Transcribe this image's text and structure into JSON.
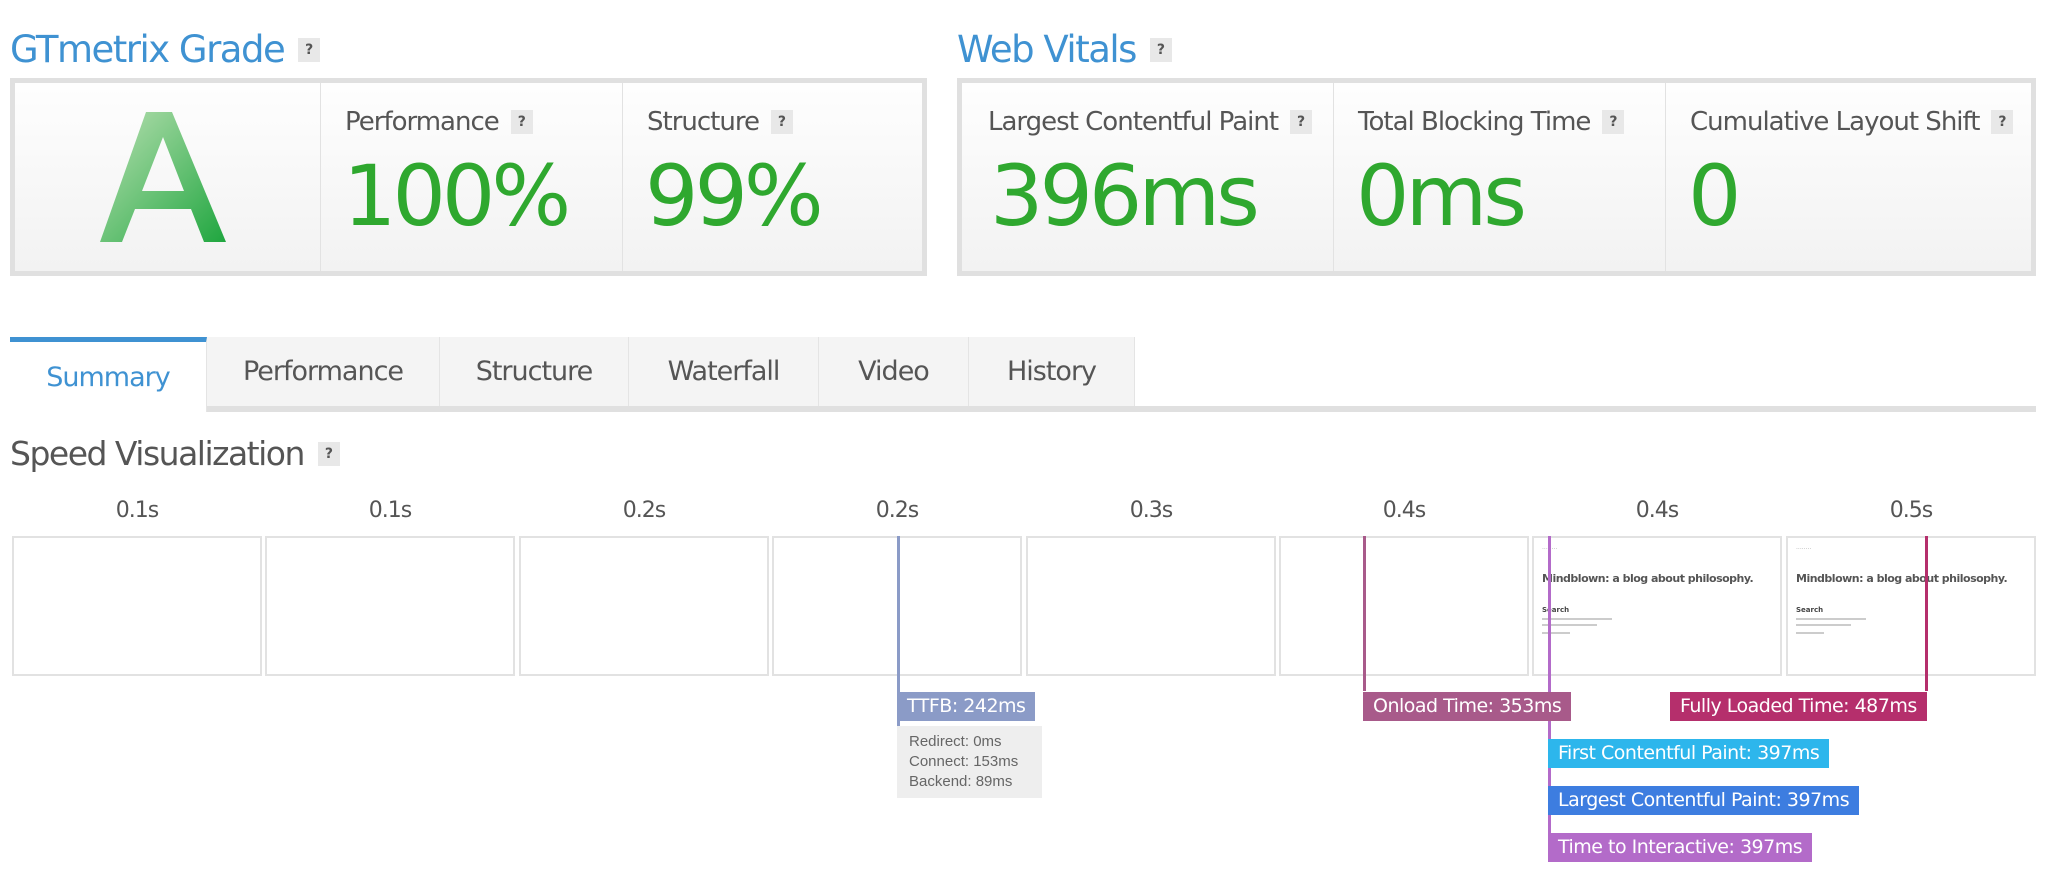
{
  "gtmetrix_grade": {
    "title": "GTmetrix Grade",
    "help_icon": "?",
    "grade": "A",
    "performance": {
      "label": "Performance",
      "value": "100%"
    },
    "structure": {
      "label": "Structure",
      "value": "99%"
    }
  },
  "web_vitals": {
    "title": "Web Vitals",
    "help_icon": "?",
    "lcp": {
      "label": "Largest Contentful Paint",
      "value": "396ms"
    },
    "tbt": {
      "label": "Total Blocking Time",
      "value": "0ms"
    },
    "cls": {
      "label": "Cumulative Layout Shift",
      "value": "0"
    }
  },
  "tabs": [
    {
      "label": "Summary",
      "active": true
    },
    {
      "label": "Performance",
      "active": false
    },
    {
      "label": "Structure",
      "active": false
    },
    {
      "label": "Waterfall",
      "active": false
    },
    {
      "label": "Video",
      "active": false
    },
    {
      "label": "History",
      "active": false
    }
  ],
  "speed_visualization": {
    "title": "Speed Visualization",
    "help_icon": "?",
    "frames": [
      {
        "time": "0.1s",
        "content": false
      },
      {
        "time": "0.1s",
        "content": false
      },
      {
        "time": "0.2s",
        "content": false
      },
      {
        "time": "0.2s",
        "content": false
      },
      {
        "time": "0.3s",
        "content": false
      },
      {
        "time": "0.4s",
        "content": false
      },
      {
        "time": "0.4s",
        "content": true
      },
      {
        "time": "0.5s",
        "content": true
      }
    ],
    "thumbnail": {
      "small_text": "········",
      "title": "Mindblown: a blog about philosophy.",
      "heading": "Search"
    },
    "markers": {
      "ttfb": {
        "label": "TTFB: 242ms",
        "color": "#8b9bc7",
        "line_color": "#8b9bc7"
      },
      "ttfb_breakdown": [
        "Redirect: 0ms",
        "Connect: 153ms",
        "Backend: 89ms"
      ],
      "onload": {
        "label": "Onload Time: 353ms",
        "color": "#a85a8a"
      },
      "fully_loaded": {
        "label": "Fully Loaded Time: 487ms",
        "color": "#b52f6c"
      },
      "fcp": {
        "label": "First Contentful Paint: 397ms",
        "color": "#2db6ec"
      },
      "lcp": {
        "label": "Largest Contentful Paint: 397ms",
        "color": "#3d7de0"
      },
      "tti": {
        "label": "Time to Interactive: 397ms",
        "color": "#b36bc9"
      }
    }
  }
}
